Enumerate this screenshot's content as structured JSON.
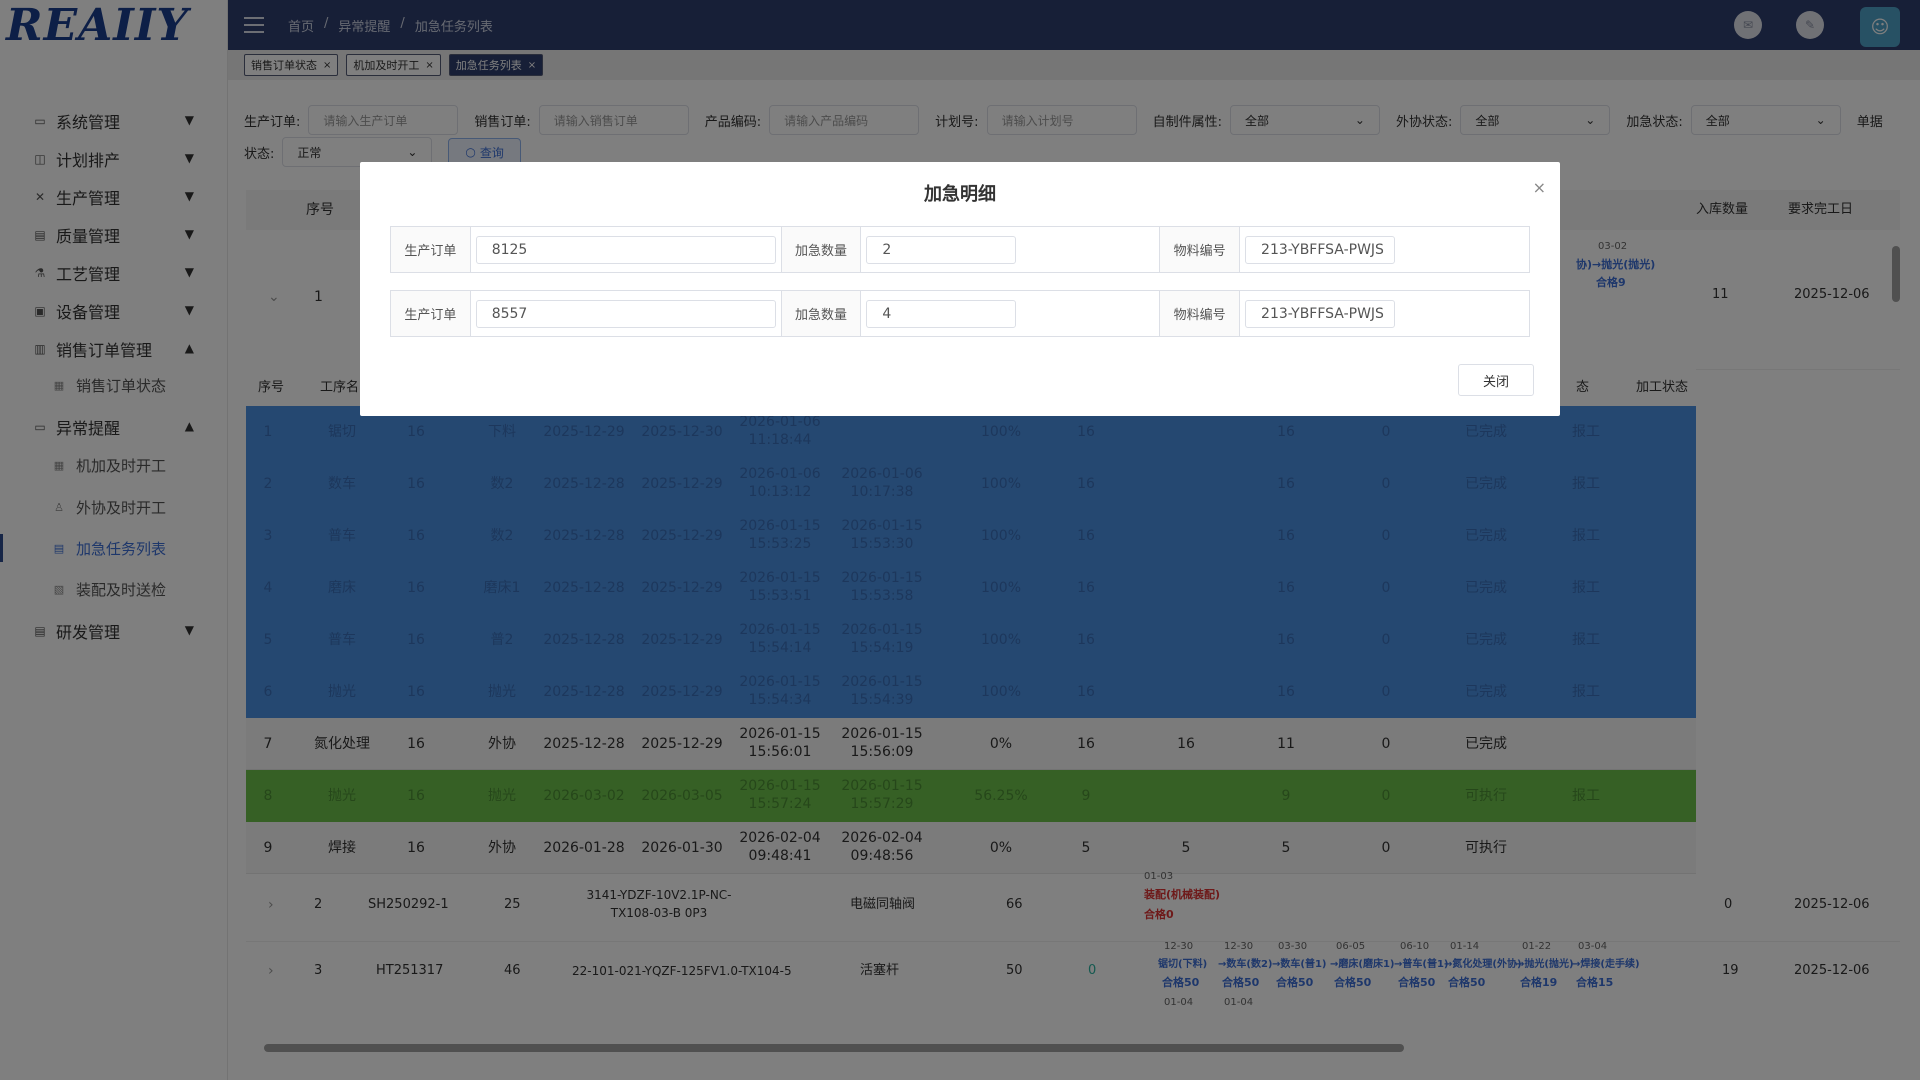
{
  "logo": {
    "text": "REAIIY"
  },
  "sidebar": {
    "items": [
      {
        "label": "系统管理",
        "icon": "monitor-icon",
        "arrow": "▼"
      },
      {
        "label": "计划排产",
        "icon": "plan-icon",
        "arrow": "▼"
      },
      {
        "label": "生产管理",
        "icon": "tools-icon",
        "arrow": "▼"
      },
      {
        "label": "质量管理",
        "icon": "document-icon",
        "arrow": "▼"
      },
      {
        "label": "工艺管理",
        "icon": "flask-icon",
        "arrow": "▼"
      },
      {
        "label": "设备管理",
        "icon": "device-icon",
        "arrow": "▼"
      },
      {
        "label": "销售订单管理",
        "icon": "order-icon",
        "arrow": "▲"
      },
      {
        "label": "异常提醒",
        "icon": "alert-monitor-icon",
        "arrow": "▲"
      },
      {
        "label": "研发管理",
        "icon": "research-icon",
        "arrow": "▼"
      }
    ],
    "sub_sales": [
      {
        "label": "销售订单状态"
      }
    ],
    "sub_alert": [
      {
        "label": "机加及时开工"
      },
      {
        "label": "外协及时开工"
      },
      {
        "label": "加急任务列表"
      },
      {
        "label": "装配及时送检"
      }
    ]
  },
  "header": {
    "breadcrumb": [
      "首页",
      "/",
      "异常提醒",
      "/",
      "加急任务列表"
    ]
  },
  "tabs": [
    {
      "label": "销售订单状态",
      "close": "×"
    },
    {
      "label": "机加及时开工",
      "close": "×"
    },
    {
      "label": "加急任务列表",
      "close": "×"
    }
  ],
  "filters": {
    "prod_order_label": "生产订单:",
    "prod_order_ph": "请输入生产订单",
    "sales_order_label": "销售订单:",
    "sales_order_ph": "请输入销售订单",
    "product_code_label": "产品编码:",
    "product_code_ph": "请输入产品编码",
    "plan_no_label": "计划号:",
    "plan_no_ph": "请输入计划号",
    "self_made_label": "自制件属性:",
    "self_made_value": "全部",
    "outsource_label": "外协状态:",
    "outsource_value": "全部",
    "urgent_label": "加急状态:",
    "urgent_value": "全部",
    "doc_label": "单据",
    "status_label": "状态:",
    "status_value": "正常",
    "query_label": "查询"
  },
  "main_headers": {
    "seq": "序号",
    "in_qty": "入库数量",
    "due": "要求完工日"
  },
  "order1": {
    "seq": "1",
    "date": "03-02",
    "proc": "协)→抛光(抛光)",
    "pass": "合格9",
    "in_qty": "11",
    "due": "2025-12-06"
  },
  "sub_headers": {
    "seq": "序号",
    "name": "工序名",
    "status_short": "态",
    "proc_status": "加工状态"
  },
  "sub_rows": [
    {
      "seq": "1",
      "name": "锯切",
      "qty": "16",
      "step": "下料",
      "ps": "2025-12-29",
      "pe": "2025-12-30",
      "as": "2026-01-06 11:18:44",
      "ae": "",
      "pct": "100%",
      "q1": "16",
      "q2": "",
      "q3": "16",
      "q4": "0",
      "st": "已完成",
      "op": "报工",
      "style": "blue"
    },
    {
      "seq": "2",
      "name": "数车",
      "qty": "16",
      "step": "数2",
      "ps": "2025-12-28",
      "pe": "2025-12-29",
      "as": "2026-01-06 10:13:12",
      "ae": "2026-01-06 10:17:38",
      "pct": "100%",
      "q1": "16",
      "q2": "",
      "q3": "16",
      "q4": "0",
      "st": "已完成",
      "op": "报工",
      "style": "blue"
    },
    {
      "seq": "3",
      "name": "普车",
      "qty": "16",
      "step": "数2",
      "ps": "2025-12-28",
      "pe": "2025-12-29",
      "as": "2026-01-15 15:53:25",
      "ae": "2026-01-15 15:53:30",
      "pct": "100%",
      "q1": "16",
      "q2": "",
      "q3": "16",
      "q4": "0",
      "st": "已完成",
      "op": "报工",
      "style": "blue"
    },
    {
      "seq": "4",
      "name": "磨床",
      "qty": "16",
      "step": "磨床1",
      "ps": "2025-12-28",
      "pe": "2025-12-29",
      "as": "2026-01-15 15:53:51",
      "ae": "2026-01-15 15:53:58",
      "pct": "100%",
      "q1": "16",
      "q2": "",
      "q3": "16",
      "q4": "0",
      "st": "已完成",
      "op": "报工",
      "style": "blue"
    },
    {
      "seq": "5",
      "name": "普车",
      "qty": "16",
      "step": "普2",
      "ps": "2025-12-28",
      "pe": "2025-12-29",
      "as": "2026-01-15 15:54:14",
      "ae": "2026-01-15 15:54:19",
      "pct": "100%",
      "q1": "16",
      "q2": "",
      "q3": "16",
      "q4": "0",
      "st": "已完成",
      "op": "报工",
      "style": "blue"
    },
    {
      "seq": "6",
      "name": "抛光",
      "qty": "16",
      "step": "抛光",
      "ps": "2025-12-28",
      "pe": "2025-12-29",
      "as": "2026-01-15 15:54:34",
      "ae": "2026-01-15 15:54:39",
      "pct": "100%",
      "q1": "16",
      "q2": "",
      "q3": "16",
      "q4": "0",
      "st": "已完成",
      "op": "报工",
      "style": "blue"
    },
    {
      "seq": "7",
      "name": "氮化处理",
      "qty": "16",
      "step": "外协",
      "ps": "2025-12-28",
      "pe": "2025-12-29",
      "as": "2026-01-15 15:56:01",
      "ae": "2026-01-15 15:56:09",
      "pct": "0%",
      "q1": "16",
      "q2": "16",
      "q3": "11",
      "q4": "0",
      "st": "已完成",
      "op": "",
      "style": "gray"
    },
    {
      "seq": "8",
      "name": "抛光",
      "qty": "16",
      "step": "抛光",
      "ps": "2026-03-02",
      "pe": "2026-03-05",
      "as": "2026-01-15 15:57:24",
      "ae": "2026-01-15 15:57:29",
      "pct": "56.25%",
      "q1": "9",
      "q2": "",
      "q3": "9",
      "q4": "0",
      "st": "可执行",
      "op": "报工",
      "style": "green"
    },
    {
      "seq": "9",
      "name": "焊接",
      "qty": "16",
      "step": "外协",
      "ps": "2026-01-28",
      "pe": "2026-01-30",
      "as": "2026-02-04 09:48:41",
      "ae": "2026-02-04 09:48:56",
      "pct": "0%",
      "q1": "5",
      "q2": "5",
      "q3": "5",
      "q4": "0",
      "st": "可执行",
      "op": "",
      "style": "gray"
    }
  ],
  "order2": {
    "seq": "2",
    "no": "SH250292-1",
    "qty": "25",
    "code": "3141-YDZF-10V2.1P-NC-TX108-03-B 0P3",
    "name": "电磁同轴阀",
    "num": "66",
    "date": "01-03",
    "proc": "装配(机械装配)",
    "pass": "合格0",
    "in_qty": "0",
    "due": "2025-12-06"
  },
  "order3": {
    "seq": "3",
    "no": "HT251317",
    "qty": "46",
    "code": "22-101-021-YQZF-125FV1.0-TX104-5",
    "name": "活塞杆",
    "num": "50",
    "zero": "0",
    "dates": [
      "12-30",
      "12-30",
      "03-30",
      "06-05",
      "06-10",
      "01-14",
      "01-22",
      "03-04"
    ],
    "procs": [
      "锯切(下料)",
      "→数车(数2)",
      "→数车(普1)",
      "→磨床(磨床1)",
      "→普车(普1)",
      "→氮化处理(外协)",
      "→抛光(抛光)",
      "→焊接(走手续)"
    ],
    "passes": [
      "合格50",
      "合格50",
      "合格50",
      "合格50",
      "合格50",
      "合格50",
      "合格19",
      "合格15"
    ],
    "dates2": [
      "01-04",
      "01-04"
    ],
    "in_qty": "19",
    "due": "2025-12-06"
  },
  "modal": {
    "title": "加急明细",
    "close_icon": "×",
    "rows": [
      {
        "order_label": "生产订单",
        "order": "8125",
        "qty_label": "加急数量",
        "qty": "2",
        "mat_label": "物料编号",
        "mat": "213-YBFFSA-PWJS"
      },
      {
        "order_label": "生产订单",
        "order": "8557",
        "qty_label": "加急数量",
        "qty": "4",
        "mat_label": "物料编号",
        "mat": "213-YBFFSA-PWJS"
      }
    ],
    "close_button": "关闭"
  }
}
